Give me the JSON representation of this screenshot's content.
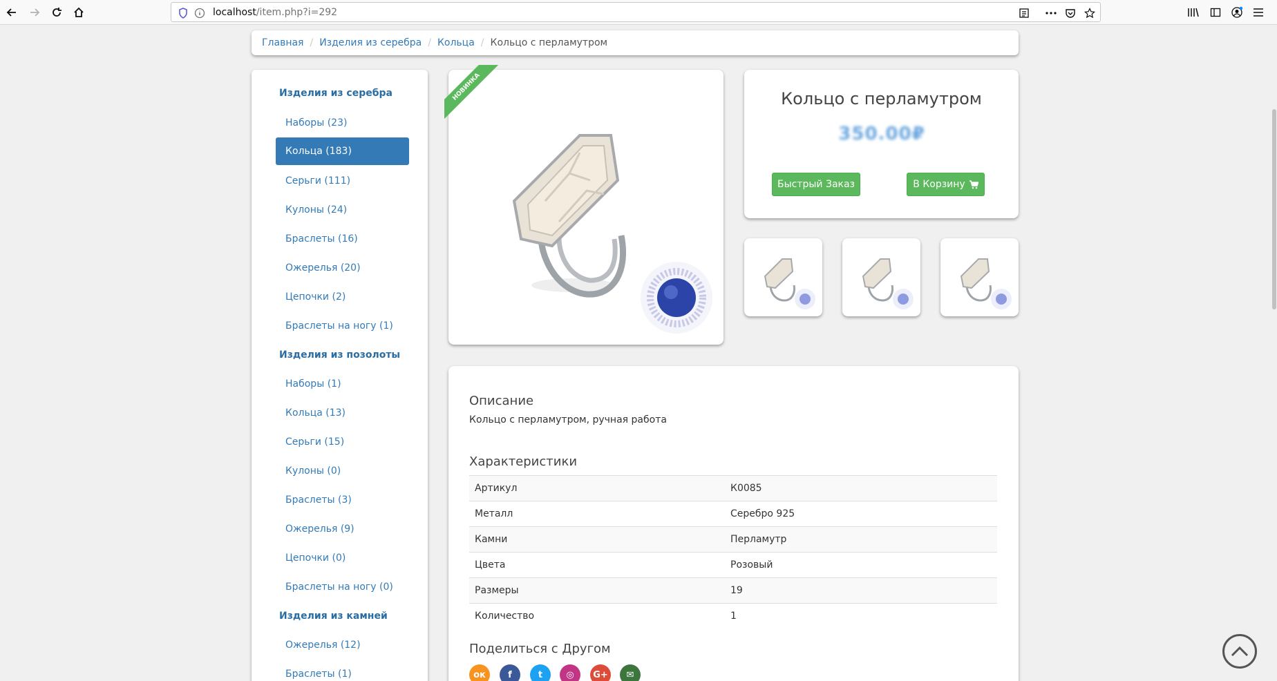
{
  "browser": {
    "url_host": "localhost",
    "url_path": "/item.php?i=292"
  },
  "breadcrumb": {
    "items": [
      "Главная",
      "Изделия из серебра",
      "Кольца"
    ],
    "current": "Кольцо с перламутром"
  },
  "sidebar": {
    "groups": [
      {
        "title": "Изделия из серебра",
        "items": [
          "Наборы (23)",
          "Кольца (183)",
          "Серьги (111)",
          "Кулоны (24)",
          "Браслеты (16)",
          "Ожерелья (20)",
          "Цепочки (2)",
          "Браслеты на ногу (1)"
        ]
      },
      {
        "title": "Изделия из позолоты",
        "items": [
          "Наборы (1)",
          "Кольца (13)",
          "Серьги (15)",
          "Кулоны (0)",
          "Браслеты (3)",
          "Ожерелья (9)",
          "Цепочки (0)",
          "Браслеты на ногу (0)"
        ]
      },
      {
        "title": "Изделия из камней",
        "items": [
          "Ожерелья (12)",
          "Браслеты (1)"
        ]
      }
    ],
    "active_item": "Кольца (183)"
  },
  "product": {
    "badge": "НОВИНКА",
    "title": "Кольцо с перламутром",
    "price": "350.00₽",
    "quick_order": "Быстрый Заказ",
    "add_to_cart": "В Корзину"
  },
  "description": {
    "heading": "Описание",
    "text": "Кольцо с перламутром, ручная работа",
    "specs_heading": "Характеристики",
    "specs": [
      {
        "key": "Артикул",
        "value": "К0085"
      },
      {
        "key": "Металл",
        "value": "Серебро 925"
      },
      {
        "key": "Камни",
        "value": "Перламутр"
      },
      {
        "key": "Цвета",
        "value": "Розовый"
      },
      {
        "key": "Размеры",
        "value": "19"
      },
      {
        "key": "Количество",
        "value": "1"
      }
    ],
    "share_heading": "Поделиться с Другом"
  },
  "share_icons": [
    {
      "name": "odnoklassniki-icon",
      "color": "#f7931e",
      "glyph": "ок"
    },
    {
      "name": "facebook-icon",
      "color": "#3b5998",
      "glyph": "f"
    },
    {
      "name": "twitter-icon",
      "color": "#1da1f2",
      "glyph": "t"
    },
    {
      "name": "instagram-icon",
      "color": "#c13584",
      "glyph": "◎"
    },
    {
      "name": "google-plus-icon",
      "color": "#dd4b39",
      "glyph": "G+"
    },
    {
      "name": "email-icon",
      "color": "#3c763d",
      "glyph": "✉"
    }
  ],
  "colors": {
    "link": "#337ab7",
    "active": "#337ab7",
    "button_green": "#5cb85c"
  }
}
